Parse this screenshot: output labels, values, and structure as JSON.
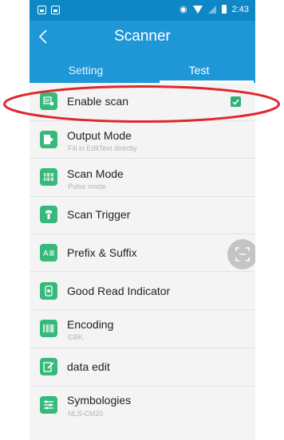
{
  "status_bar": {
    "time": "2:43",
    "icons": [
      "notification-icon",
      "notification-icon",
      "vibrate-icon",
      "wifi-icon",
      "signal-icon",
      "battery-icon"
    ]
  },
  "app_bar": {
    "title": "Scanner",
    "back_icon": "chevron-left-icon"
  },
  "tabs": [
    {
      "label": "Setting",
      "selected": false
    },
    {
      "label": "Test",
      "selected": true
    }
  ],
  "settings": [
    {
      "title": "Enable scan",
      "subtitle": "",
      "icon": "enable-scan-icon",
      "checked": true
    },
    {
      "title": "Output Mode",
      "subtitle": "Fill in EditText directly",
      "icon": "output-mode-icon"
    },
    {
      "title": "Scan Mode",
      "subtitle": "Pulse mode",
      "icon": "scan-mode-icon"
    },
    {
      "title": "Scan Trigger",
      "subtitle": "",
      "icon": "scan-trigger-icon"
    },
    {
      "title": "Prefix & Suffix",
      "subtitle": "",
      "icon": "prefix-suffix-icon"
    },
    {
      "title": "Good Read Indicator",
      "subtitle": "",
      "icon": "good-read-indicator-icon"
    },
    {
      "title": "Encoding",
      "subtitle": "GBK",
      "icon": "encoding-icon"
    },
    {
      "title": "data edit",
      "subtitle": "",
      "icon": "data-edit-icon"
    },
    {
      "title": "Symbologies",
      "subtitle": "NLS-CM20",
      "icon": "symbologies-icon"
    }
  ],
  "floating_button": {
    "icon": "scan-icon"
  },
  "colors": {
    "status_bar": "#0e87c4",
    "app_bar": "#1f97d6",
    "icon_green": "#36b97b",
    "annotation": "#e0262d",
    "list_background": "#f4f4f4"
  }
}
